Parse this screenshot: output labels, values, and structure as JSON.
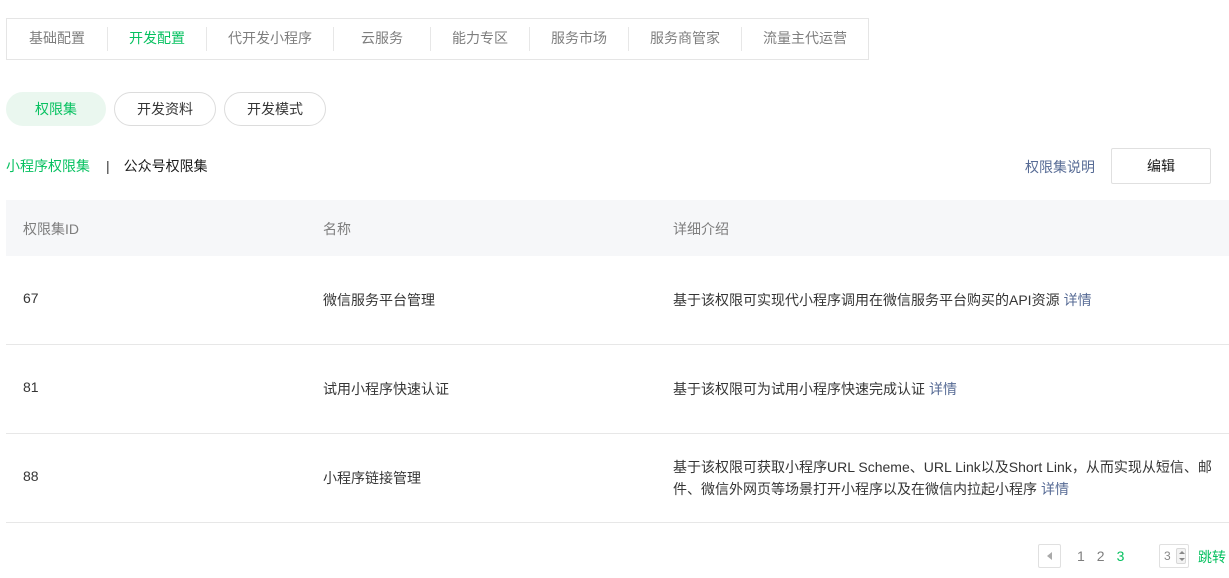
{
  "topnav": {
    "tabs": [
      {
        "label": "基础配置"
      },
      {
        "label": "开发配置"
      },
      {
        "label": "代开发小程序"
      },
      {
        "label": "云服务"
      },
      {
        "label": "能力专区"
      },
      {
        "label": "服务市场"
      },
      {
        "label": "服务商管家"
      },
      {
        "label": "流量主代运营"
      }
    ],
    "active_index": 1
  },
  "pills": [
    {
      "label": "权限集"
    },
    {
      "label": "开发资料"
    },
    {
      "label": "开发模式"
    }
  ],
  "subhead": {
    "miniprogram_label": "小程序权限集",
    "divider": "|",
    "official_label": "公众号权限集",
    "explain_label": "权限集说明",
    "edit_label": "编辑"
  },
  "table": {
    "headers": [
      "权限集ID",
      "名称",
      "详细介绍"
    ],
    "rows": [
      {
        "id": "67",
        "name": "微信服务平台管理",
        "desc": "基于该权限可实现代小程序调用在微信服务平台购买的API资源",
        "detail": "详情"
      },
      {
        "id": "81",
        "name": "试用小程序快速认证",
        "desc": "基于该权限可为试用小程序快速完成认证",
        "detail": "详情"
      },
      {
        "id": "88",
        "name": "小程序链接管理",
        "desc": "基于该权限可获取小程序URL Scheme、URL Link以及Short Link，从而实现从短信、邮件、微信外网页等场景打开小程序以及在微信内拉起小程序",
        "detail": "详情"
      }
    ]
  },
  "pagination": {
    "pages": [
      "1",
      "2",
      "3"
    ],
    "current": "3",
    "jump_value": "3",
    "jump_label": "跳转"
  },
  "colors": {
    "accent": "#07c160",
    "link": "#576b95"
  }
}
